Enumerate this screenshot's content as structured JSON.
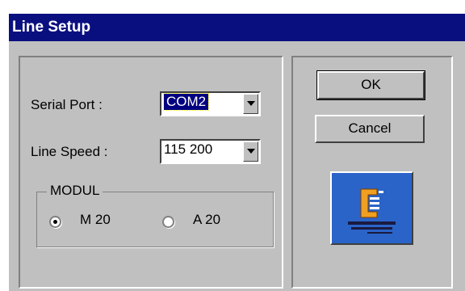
{
  "window": {
    "title": "Line Setup"
  },
  "settings": {
    "serial_port_label": "Serial Port :",
    "serial_port_value": "COM2",
    "line_speed_label": "Line Speed :",
    "line_speed_value": "115 200"
  },
  "modul": {
    "caption": "MODUL",
    "options": [
      {
        "label": "M 20",
        "checked": true
      },
      {
        "label": "A 20",
        "checked": false
      }
    ]
  },
  "buttons": {
    "ok": "OK",
    "cancel": "Cancel"
  },
  "logo": {
    "icon": "company-logo-icon"
  },
  "colors": {
    "titlebar": "#0a0f80",
    "face": "#c0c0c0",
    "logo_bg": "#2a64c8"
  }
}
